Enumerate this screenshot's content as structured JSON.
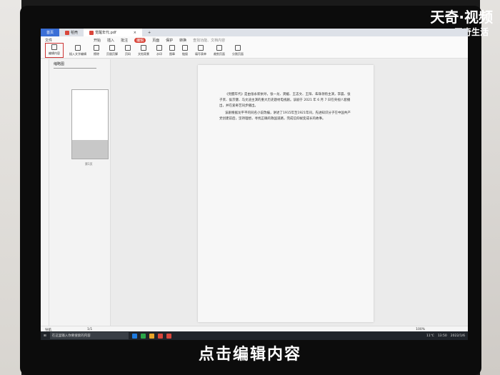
{
  "watermark": {
    "brand": "天奇·视频",
    "sub": "天奇生活"
  },
  "subtitle": "点击编辑内容",
  "tabs": [
    {
      "label": "首页"
    },
    {
      "label": "稻壳"
    },
    {
      "label": "觉醒年代.pdf"
    }
  ],
  "menu": {
    "file": "文件",
    "items": [
      "开始",
      "插入",
      "批注",
      "编辑",
      "页面",
      "保护",
      "转换"
    ],
    "active": "编辑",
    "search_placeholder": "查找功能、文档内容"
  },
  "ribbon": [
    "编辑内容",
    "插入文字编辑",
    "擦除",
    "页眉页脚",
    "页码",
    "文档背景",
    "水印",
    "图章",
    "链接",
    "填写表单",
    "裁剪页面",
    "分割页面"
  ],
  "sidebar": {
    "title": "缩略图",
    "page_label": "第1页"
  },
  "document": {
    "paragraphs": [
      "《觉醒年代》是由张永新执导，张一龙、龚媛、王志文、王阳、朱珠领衔主演，李晨、张子贤、侯京健、马文迪主演的重大历史题材电视剧。该剧于 2021 年 6 月 7 日在央视八套播出，并在爱奇艺同步播出。",
      "该剧根据龙平平的同名小说改编，讲述了1915年至1921年间，先进知识分子在中国共产党创建前后，坚持理想，寻找正确的救国道路，完成信仰蜕变成长的故事。"
    ]
  },
  "status": {
    "nav": "导航",
    "page": "1/1",
    "zoom": "100%"
  },
  "taskbar": {
    "search": "在这里输入你要搜索的内容",
    "weather": "11℃",
    "time": "13:50",
    "date": "2022/1/6"
  }
}
